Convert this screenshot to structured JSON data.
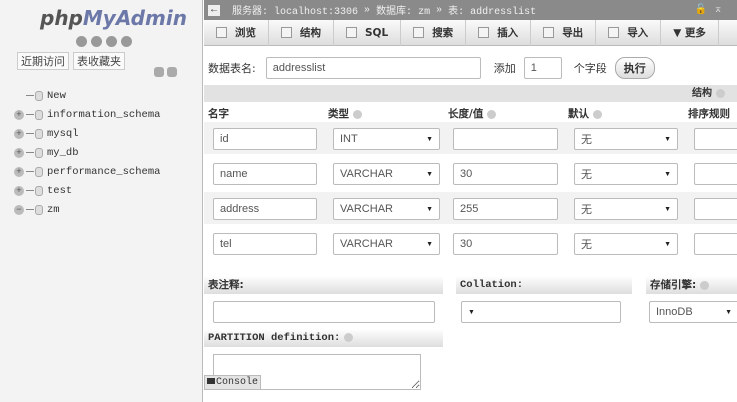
{
  "sidebar": {
    "logo_php": "php",
    "logo_rest": "MyAdmin",
    "tabs": [
      "近期访问",
      "表收藏夹"
    ],
    "tree": [
      {
        "label": "New",
        "expander": ""
      },
      {
        "label": "information_schema",
        "expander": "+"
      },
      {
        "label": "mysql",
        "expander": "+"
      },
      {
        "label": "my_db",
        "expander": "+"
      },
      {
        "label": "performance_schema",
        "expander": "+"
      },
      {
        "label": "test",
        "expander": "+"
      },
      {
        "label": "zm",
        "expander": "−"
      }
    ]
  },
  "breadcrumb": {
    "back": "←",
    "server": "服务器: localhost:3306",
    "sep": "»",
    "database": "数据库: zm",
    "table": "表: addresslist",
    "right_icons": "🔓⌅"
  },
  "toolbar": [
    "浏览",
    "结构",
    "SQL",
    "搜索",
    "插入",
    "导出",
    "导入",
    "▼ 更多"
  ],
  "form": {
    "table_name_label": "数据表名:",
    "table_name": "addresslist",
    "add_label": "添加",
    "add_count": "1",
    "fields_label": "个字段",
    "go": "执行"
  },
  "structure_label": "结构",
  "columns": {
    "name": "名字",
    "type": "类型",
    "length": "长度/值",
    "default": "默认",
    "collation": "排序规则"
  },
  "fields": [
    {
      "name": "id",
      "type": "INT",
      "length": "",
      "default": "无"
    },
    {
      "name": "name",
      "type": "VARCHAR",
      "length": "30",
      "default": "无"
    },
    {
      "name": "address",
      "type": "VARCHAR",
      "length": "255",
      "default": "无"
    },
    {
      "name": "tel",
      "type": "VARCHAR",
      "length": "30",
      "default": "无"
    }
  ],
  "bottom": {
    "comment_label": "表注释:",
    "collation_label": "Collation:",
    "engine_label": "存储引擎:",
    "engine": "InnoDB",
    "partition_label": "PARTITION definition:"
  },
  "console": "Console"
}
